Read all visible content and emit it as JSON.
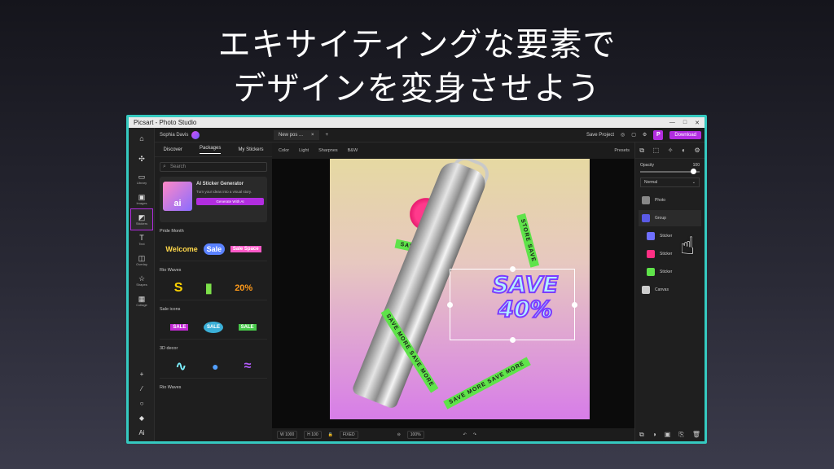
{
  "headline": {
    "line1": "エキサイティングな要素で",
    "line2": "デザインを変身させよう"
  },
  "window": {
    "title": "Picsart - Photo Studio",
    "controls": [
      "—",
      "□",
      "✕"
    ]
  },
  "topbar": {
    "user_name": "Sophia Davis",
    "doc_tab": "New pos ...",
    "doc_close": "×",
    "add_tab": "+",
    "save_project": "Save Project",
    "p_badge": "P",
    "download": "Download"
  },
  "rail": {
    "items": [
      {
        "icon": "⌂",
        "label": ""
      },
      {
        "icon": "✣",
        "label": ""
      },
      {
        "icon": "▭",
        "label": "Library"
      },
      {
        "icon": "▣",
        "label": "Images"
      },
      {
        "icon": "◩",
        "label": "Stickers"
      },
      {
        "icon": "T",
        "label": "Text"
      },
      {
        "icon": "◫",
        "label": "Overlay"
      },
      {
        "icon": "☆",
        "label": "Shapes"
      },
      {
        "icon": "▦",
        "label": "Collage"
      }
    ],
    "tools": [
      "+",
      "⁄",
      "○",
      "◆",
      "Ai"
    ]
  },
  "panel": {
    "fill_label": "Fill",
    "tabs": [
      "Discover",
      "Packages",
      "My Stickers"
    ],
    "search_placeholder": "Search",
    "ai_card": {
      "title": "AI Sticker Generator",
      "subtitle": "Turn your ideas into a visual story.",
      "button": "Generate With AI",
      "thumb": "ai"
    },
    "sections": [
      {
        "title": "Pride Month",
        "stickers": [
          "Welcome",
          "Sale",
          "Sale Space"
        ]
      },
      {
        "title": "Rio Waves",
        "stickers": [
          "S",
          "▮",
          "20%"
        ]
      },
      {
        "title": "Sale icons",
        "stickers": [
          "SALE",
          "SALE",
          "SALE"
        ]
      },
      {
        "title": "3D decor",
        "stickers": [
          "∿",
          "●",
          "≈"
        ]
      },
      {
        "title": "Rio Waves",
        "stickers": []
      }
    ]
  },
  "optbar": {
    "items": [
      "Color",
      "Light",
      "Sharpnes",
      "B&W"
    ],
    "presets": "Presets"
  },
  "canvas": {
    "sticker_text_line1": "SAVE",
    "sticker_text_line2": "40%",
    "ribbon_top": "STORE SAVE",
    "ribbon_left": "SAVE MORE SAVE MORE",
    "ribbon_bottom": "SAVE MORE SAVE MORE",
    "ribbon_top_left": "SAVE MORE"
  },
  "bottombar": {
    "w_label": "W",
    "w_value": "1000",
    "h_label": "H",
    "h_value": "100",
    "fixed": "FIXED",
    "zoom": "100%"
  },
  "rightpanel": {
    "opacity_label": "Opacity",
    "opacity_value": "100",
    "blend_mode": "Normal",
    "layers": [
      {
        "name": "Photo",
        "color": "#888888"
      },
      {
        "name": "Group",
        "color": "#5a5ae6"
      },
      {
        "name": "Sticker",
        "color": "#6f6fff"
      },
      {
        "name": "Sticker",
        "color": "#ff2f84"
      },
      {
        "name": "Sticker",
        "color": "#5fe34a"
      },
      {
        "name": "Canvas",
        "color": "#cccccc"
      }
    ]
  },
  "colors": {
    "accent": "#b22de0",
    "window_border": "#35c9c0",
    "ribbon": "#5fe34a"
  }
}
